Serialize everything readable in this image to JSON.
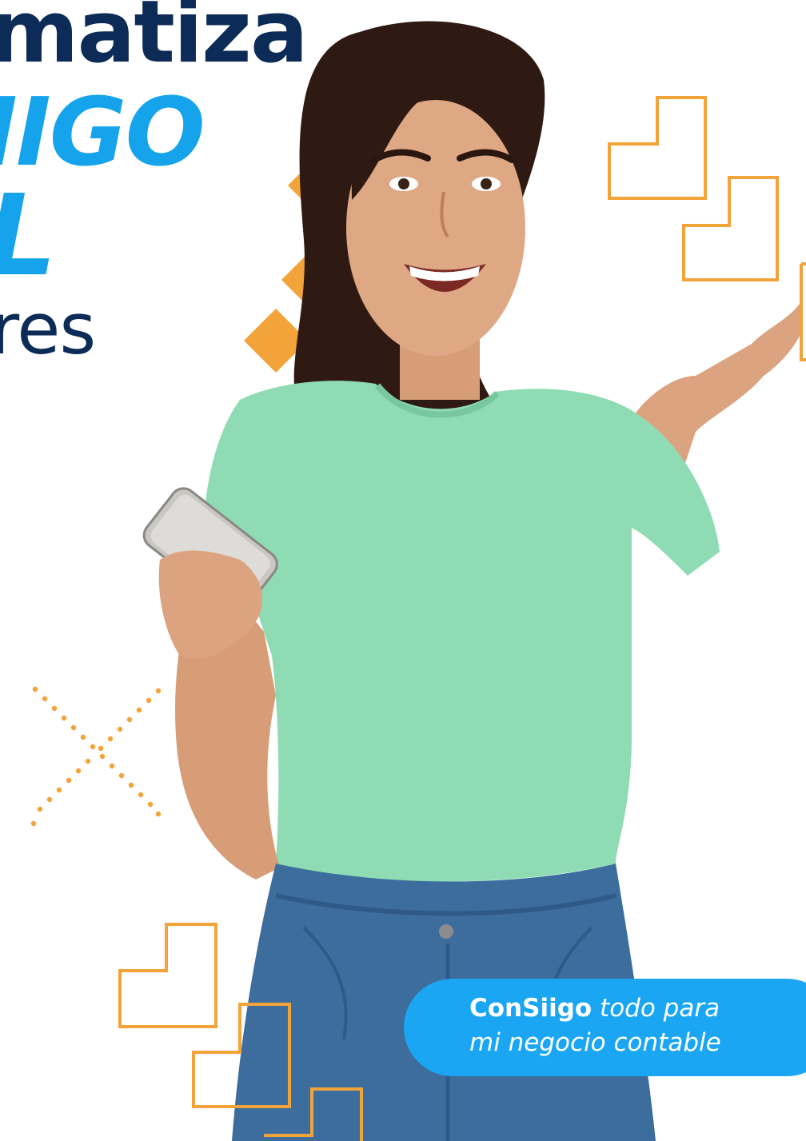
{
  "headline": {
    "line1": "matiza",
    "line2": "IIGO",
    "line3": "L",
    "line4": "res"
  },
  "badge": {
    "brand": "ConSiigo",
    "text_rest": " todo para",
    "text_line2": "mi negocio contable"
  },
  "colors": {
    "navy": "#0d2b57",
    "sky_blue": "#15a4ec",
    "badge_blue": "#1aa6f2",
    "orange": "#f2a33a",
    "shirt_green": "#8fdcb4",
    "denim": "#3d6d9c",
    "hair": "#2e1a12",
    "skin": "#d9a27c"
  },
  "photo": {
    "subject": "smiling woman in mint green t-shirt and jeans holding a smartphone, other hand raised"
  }
}
